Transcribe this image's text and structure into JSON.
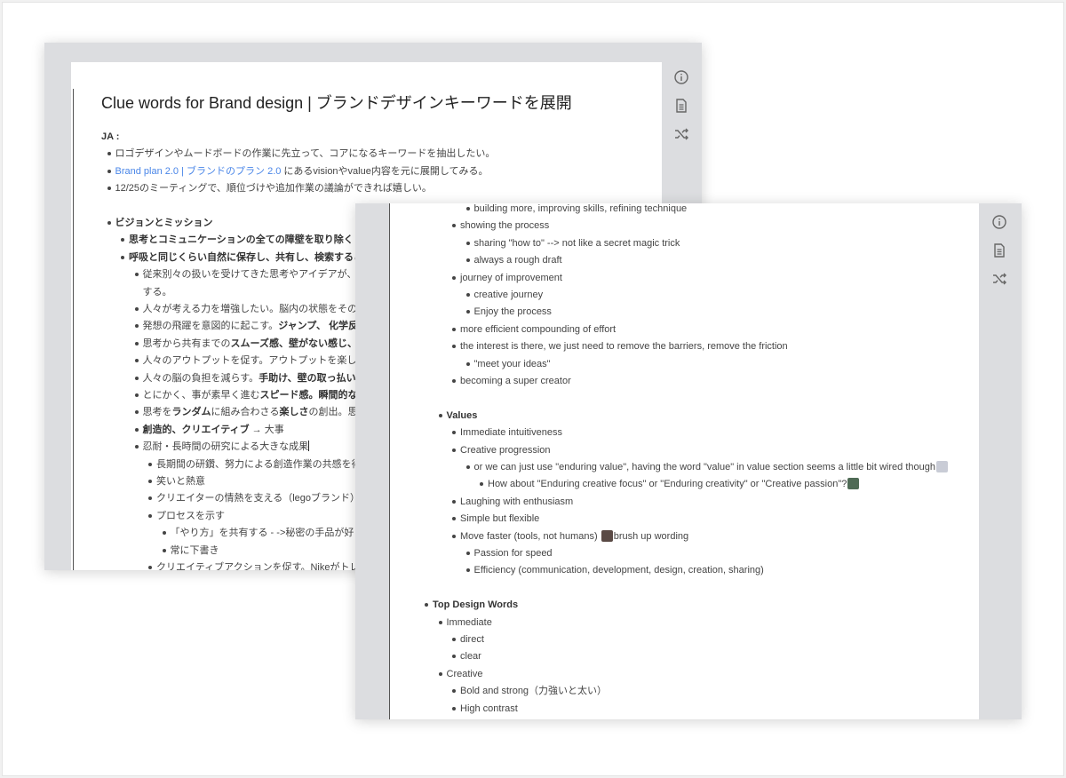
{
  "colors": {
    "link": "#4a86e8",
    "window_frame": "#dcdde0"
  },
  "side_icons": [
    "info-icon",
    "document-icon",
    "shuffle-icon"
  ],
  "back_doc": {
    "title": "Clue words for Brand design | ブランドデザインキーワードを展開",
    "lines": [
      {
        "level": 0,
        "bullet": false,
        "segs": [
          {
            "t": "JA :",
            "s": "b"
          }
        ]
      },
      {
        "level": 1,
        "segs": [
          {
            "t": "ロゴデザインやムードボードの作業に先立って、コアになるキーワードを抽出したい。"
          }
        ]
      },
      {
        "level": 1,
        "segs": [
          {
            "t": "Brand plan 2.0 | ブランドのプラン 2.0",
            "s": "link"
          },
          {
            "t": " にあるvisionやvalue内容を元に展開してみる。"
          }
        ]
      },
      {
        "level": 1,
        "segs": [
          {
            "t": "12/25のミーティングで、順位づけや追加作業の議論ができれば嬉しい。"
          }
        ]
      },
      {
        "blank": true
      },
      {
        "level": 1,
        "segs": [
          {
            "t": "ビジョンとミッション",
            "s": "b"
          }
        ]
      },
      {
        "level": 2,
        "segs": [
          {
            "t": "思考とコミュニケーションの全ての障壁を取り除く",
            "s": "b"
          }
        ]
      },
      {
        "level": 2,
        "segs": [
          {
            "t": "呼吸と同じくらい自然に保存し、共有し、検索すること",
            "s": "b"
          }
        ]
      },
      {
        "level": 3,
        "segs": [
          {
            "t": "従来別々の扱いを受けてきた思考やアイデアが、"
          },
          {
            "t": "有",
            "s": "b"
          }
        ]
      },
      {
        "level": 3,
        "bullet": false,
        "segs": [
          {
            "t": "する。"
          }
        ]
      },
      {
        "level": 3,
        "segs": [
          {
            "t": "人々が考える力を増強したい。脳内の状態をそのま"
          }
        ]
      },
      {
        "level": 3,
        "segs": [
          {
            "t": "発想の飛躍を意図的に起こす。"
          },
          {
            "t": "ジャンプ、 化学反応",
            "s": "b"
          }
        ]
      },
      {
        "level": 3,
        "segs": [
          {
            "t": "思考から共有までの"
          },
          {
            "t": "スムーズ感、壁がない感じ、ポ",
            "s": "b"
          }
        ]
      },
      {
        "level": 3,
        "segs": [
          {
            "t": "人々のアウトプットを促す。アウトプットを楽しく"
          }
        ]
      },
      {
        "level": 3,
        "segs": [
          {
            "t": "人々の脳の負担を減らす。"
          },
          {
            "t": "手助け、壁の取っ払いや",
            "s": "b"
          }
        ]
      },
      {
        "level": 3,
        "segs": [
          {
            "t": "とにかく、事が素早く進む"
          },
          {
            "t": "スピード感。瞬間的なア",
            "s": "b"
          }
        ]
      },
      {
        "level": 3,
        "segs": [
          {
            "t": "思考を"
          },
          {
            "t": "ランダム",
            "s": "b"
          },
          {
            "t": "に組み合わさる"
          },
          {
            "t": "楽しさ",
            "s": "b"
          },
          {
            "t": "の創出。思考"
          }
        ]
      },
      {
        "level": 3,
        "segs": [
          {
            "t": "創造的、クリエイティブ",
            "s": "b"
          },
          {
            "t": " → 大事"
          }
        ]
      },
      {
        "level": 3,
        "caret": true,
        "segs": [
          {
            "t": "忍耐・長時間の研究による大きな成果"
          }
        ]
      },
      {
        "level": 4,
        "segs": [
          {
            "t": "長期間の研鑽、努力による創造作業の共感を得た"
          }
        ]
      },
      {
        "level": 4,
        "segs": [
          {
            "t": "笑いと熱意"
          }
        ]
      },
      {
        "level": 4,
        "segs": [
          {
            "t": "クリエイターの情熱を支える（legoブランド）"
          }
        ]
      },
      {
        "level": 4,
        "segs": [
          {
            "t": "プロセスを示す"
          }
        ]
      },
      {
        "level": 5,
        "segs": [
          {
            "t": "「やり方」を共有する - ->秘密の手品が好きで"
          }
        ]
      },
      {
        "level": 5,
        "segs": [
          {
            "t": "常に下書き"
          }
        ]
      },
      {
        "level": 4,
        "segs": [
          {
            "t": "クリエイティブアクションを促す。Nikeがトレー"
          }
        ]
      }
    ]
  },
  "front_doc": {
    "lines": [
      {
        "level": 3,
        "segs": [
          {
            "t": "building more, improving skills, refining technique"
          }
        ]
      },
      {
        "level": 2,
        "segs": [
          {
            "t": "showing the process"
          }
        ]
      },
      {
        "level": 3,
        "segs": [
          {
            "t": "sharing \"how to\" --> not like a secret magic trick"
          }
        ]
      },
      {
        "level": 3,
        "segs": [
          {
            "t": "always a rough draft"
          }
        ]
      },
      {
        "level": 2,
        "segs": [
          {
            "t": "journey of improvement"
          }
        ]
      },
      {
        "level": 3,
        "segs": [
          {
            "t": "creative journey"
          }
        ]
      },
      {
        "level": 3,
        "segs": [
          {
            "t": "Enjoy the process"
          }
        ]
      },
      {
        "level": 2,
        "segs": [
          {
            "t": "more efficient compounding of effort"
          }
        ]
      },
      {
        "level": 2,
        "segs": [
          {
            "t": "the interest is there, we just need to remove the barriers, remove the friction"
          }
        ]
      },
      {
        "level": 3,
        "segs": [
          {
            "t": "\"meet your ideas\""
          }
        ]
      },
      {
        "level": 2,
        "segs": [
          {
            "t": "becoming a super creator"
          }
        ]
      },
      {
        "blank": true
      },
      {
        "level": 1,
        "segs": [
          {
            "t": "Values",
            "s": "b"
          }
        ]
      },
      {
        "level": 2,
        "segs": [
          {
            "t": "Immediate intuitiveness"
          }
        ]
      },
      {
        "level": 2,
        "segs": [
          {
            "t": "Creative progression"
          }
        ]
      },
      {
        "level": 3,
        "avatar": "#c9ccd6",
        "segs": [
          {
            "t": "or we can just use \"enduring value\", having the word \"value\" in value section seems a little bit wired though"
          }
        ]
      },
      {
        "level": 4,
        "avatar": "#4f6b55",
        "segs": [
          {
            "t": "How about \"Enduring creative focus\" or \"Enduring creativity\" or \"Creative passion\"?"
          }
        ]
      },
      {
        "level": 2,
        "segs": [
          {
            "t": "Laughing with enthusiasm"
          }
        ]
      },
      {
        "level": 2,
        "segs": [
          {
            "t": "Simple but flexible"
          }
        ]
      },
      {
        "level": 2,
        "midavatar": "#5a4a45",
        "segs": [
          {
            "t": "Move faster (tools, not humans) "
          },
          {
            "t": "brush up wording"
          }
        ]
      },
      {
        "level": 3,
        "segs": [
          {
            "t": "Passion for speed"
          }
        ]
      },
      {
        "level": 3,
        "segs": [
          {
            "t": "Efficiency (communication, development, design, creation, sharing)"
          }
        ]
      },
      {
        "blank": true
      },
      {
        "level": 0,
        "segs": [
          {
            "t": "Top Design Words",
            "s": "b"
          }
        ]
      },
      {
        "level": 1,
        "segs": [
          {
            "t": "Immediate"
          }
        ]
      },
      {
        "level": 2,
        "segs": [
          {
            "t": "direct"
          }
        ]
      },
      {
        "level": 2,
        "segs": [
          {
            "t": "clear"
          }
        ]
      },
      {
        "level": 1,
        "segs": [
          {
            "t": "Creative"
          }
        ]
      },
      {
        "level": 2,
        "segs": [
          {
            "t": "Bold and strong（力強いと太い）"
          }
        ]
      },
      {
        "level": 2,
        "segs": [
          {
            "t": "High contrast"
          }
        ]
      }
    ]
  }
}
